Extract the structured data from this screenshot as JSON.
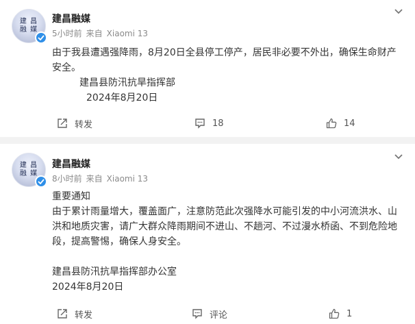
{
  "posts": [
    {
      "author": "建昌融媒",
      "time": "5小时前",
      "source_prefix": "来自",
      "source_device": "Xiaomi 13",
      "avatar_logo": [
        "建",
        "昌",
        "融",
        "媒"
      ],
      "lines": [
        "由于我县遭遇强降雨，8月20日全县停工停产，居民非必要不外出，确保生命财产",
        "安全。",
        "建昌县防汛抗旱指挥部",
        "2024年8月20日"
      ],
      "repost_label": "转发",
      "comment_count": "18",
      "like_count": "14"
    },
    {
      "author": "建昌融媒",
      "time": "8小时前",
      "source_prefix": "来自",
      "source_device": "Xiaomi 13",
      "avatar_logo": [
        "建",
        "昌",
        "融",
        "媒"
      ],
      "lines": [
        "重要通知",
        "由于累计雨量增大，覆盖面广，注意防范此次强降水可能引发的中小河流洪水、山",
        "洪和地质灾害，请广大群众降雨期间不进山、不趟河、不过漫水桥函、不到危险地",
        "段，提高警惕，确保人身安全。",
        "建昌县防汛抗旱指挥部办公室",
        "2024年8月20日"
      ],
      "repost_label": "转发",
      "comment_label": "评论",
      "like_count": "1"
    }
  ],
  "colors": {
    "background": "#f2f2f2",
    "card": "#ffffff",
    "verified_badge": "#2f8fe8",
    "meta_text": "#8a8a8a"
  },
  "icons": {
    "repost": "repost-icon",
    "comment": "comment-icon",
    "like": "like-icon",
    "more": "chevron-down-icon",
    "verified": "verified-badge-icon"
  }
}
